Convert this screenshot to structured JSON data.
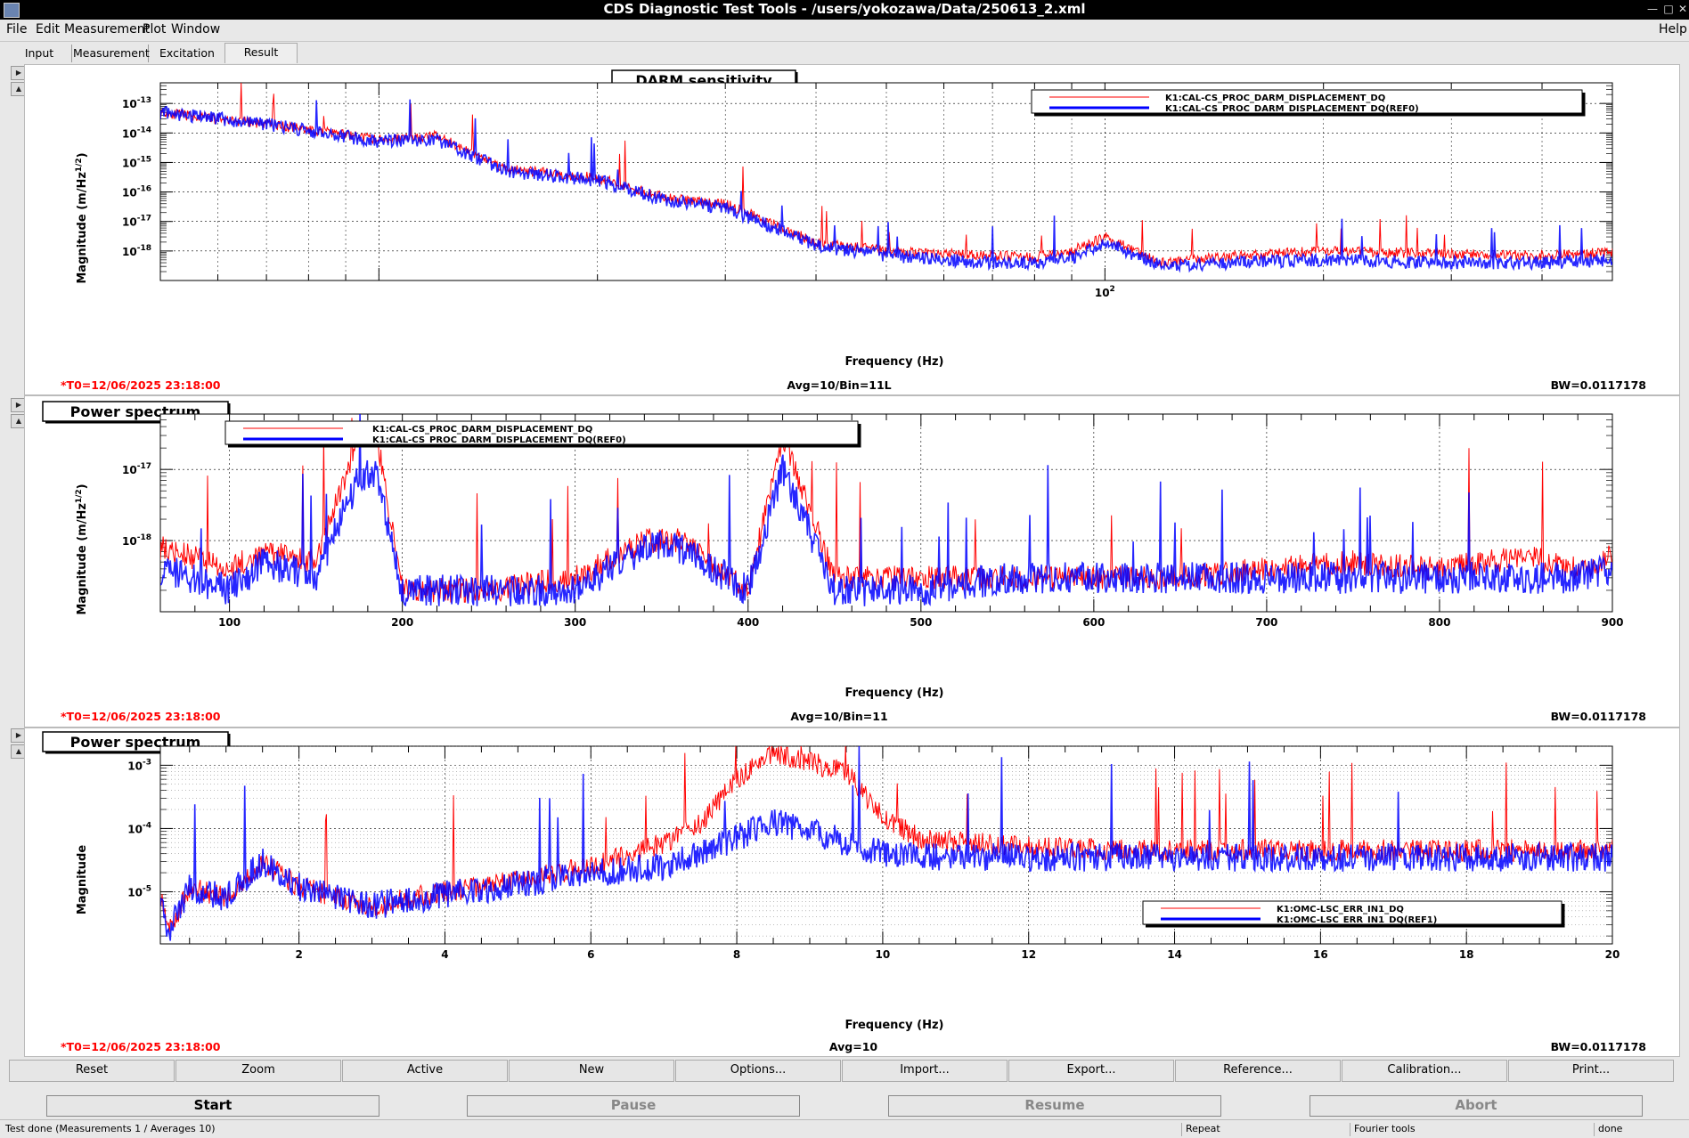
{
  "window": {
    "title": "CDS Diagnostic Test Tools - /users/yokozawa/Data/250613_2.xml"
  },
  "menu": {
    "file": "File",
    "edit": "Edit",
    "measurement": "Measurement",
    "plot": "Plot",
    "window": "Window",
    "help": "Help"
  },
  "tabs": [
    "Input",
    "Measurement",
    "Excitation",
    "Result"
  ],
  "colors": {
    "red": "#ff0000",
    "blue": "#0000ff",
    "info_red": "#ff0000"
  },
  "panels": [
    {
      "title": "DARM sensitivity",
      "ylabel_main": "Magnitude (m/Hz",
      "ylabel_sup": "1/2",
      "ylabel_end": ")",
      "xlabel": "Frequency (Hz)",
      "info_left": "*T0=12/06/2025 23:18:00",
      "info_center": "Avg=10/Bin=11L",
      "info_right": "BW=0.0117178",
      "ytick_labels": [
        {
          "base": "10",
          "exp": "-13"
        },
        {
          "base": "10",
          "exp": "-14"
        },
        {
          "base": "10",
          "exp": "-15"
        },
        {
          "base": "10",
          "exp": "-16"
        },
        {
          "base": "10",
          "exp": "-17"
        },
        {
          "base": "10",
          "exp": "-18"
        }
      ],
      "xtick_labels": [
        {
          "base": "10",
          "exp": "2"
        }
      ],
      "legend": [
        "K1:CAL-CS_PROC_DARM_DISPLACEMENT_DQ",
        "K1:CAL-CS_PROC_DARM_DISPLACEMENT_DQ(REF0)"
      ]
    },
    {
      "title": "Power spectrum",
      "ylabel_main": "Magnitude (m/Hz",
      "ylabel_sup": "1/2",
      "ylabel_end": ")",
      "xlabel": "Frequency (Hz)",
      "info_left": "*T0=12/06/2025 23:18:00",
      "info_center": "Avg=10/Bin=11",
      "info_right": "BW=0.0117178",
      "ytick_labels": [
        {
          "base": "10",
          "exp": "-17"
        },
        {
          "base": "10",
          "exp": "-18"
        }
      ],
      "xtick_labels": [
        "100",
        "200",
        "300",
        "400",
        "500",
        "600",
        "700",
        "800",
        "900"
      ],
      "legend": [
        "K1:CAL-CS_PROC_DARM_DISPLACEMENT_DQ",
        "K1:CAL-CS_PROC_DARM_DISPLACEMENT_DQ(REF0)"
      ]
    },
    {
      "title": "Power spectrum",
      "ylabel_main": "Magnitude",
      "ylabel_sup": "",
      "ylabel_end": "",
      "xlabel": "Frequency (Hz)",
      "info_left": "*T0=12/06/2025 23:18:00",
      "info_center": "Avg=10",
      "info_right": "BW=0.0117178",
      "ytick_labels": [
        {
          "base": "10",
          "exp": "-3"
        },
        {
          "base": "10",
          "exp": "-4"
        },
        {
          "base": "10",
          "exp": "-5"
        }
      ],
      "xtick_labels": [
        "2",
        "4",
        "6",
        "8",
        "10",
        "12",
        "14",
        "16",
        "18",
        "20"
      ],
      "legend": [
        "K1:OMC-LSC_ERR_IN1_DQ",
        "K1:OMC-LSC_ERR_IN1_DQ(REF1)"
      ]
    }
  ],
  "chart_data": [
    {
      "type": "line",
      "title": "DARM sensitivity",
      "xlabel": "Frequency (Hz)",
      "ylabel": "Magnitude (m/Hz^1/2)",
      "xscale": "log",
      "yscale": "log",
      "xlim": [
        5,
        500
      ],
      "ylim": [
        1e-19,
        5e-13
      ],
      "grid": true,
      "legend_position": "top-right",
      "series": [
        {
          "name": "K1:CAL-CS_PROC_DARM_DISPLACEMENT_DQ",
          "x": [
            5,
            7,
            10,
            12,
            15,
            20,
            25,
            30,
            40,
            50,
            60,
            70,
            80,
            90,
            100,
            120,
            150,
            200,
            300,
            400,
            500
          ],
          "y": [
            5e-14,
            2e-14,
            6e-15,
            8e-15,
            6e-16,
            3e-16,
            6e-17,
            4e-17,
            2e-18,
            1e-18,
            8e-19,
            7e-19,
            6e-19,
            1e-18,
            3e-18,
            4e-19,
            7e-19,
            1e-18,
            8e-19,
            7e-19,
            9e-19
          ]
        },
        {
          "name": "K1:CAL-CS_PROC_DARM_DISPLACEMENT_DQ(REF0)",
          "x": [
            5,
            7,
            10,
            12,
            15,
            20,
            25,
            30,
            40,
            50,
            60,
            70,
            80,
            90,
            100,
            120,
            150,
            200,
            300,
            400,
            500
          ],
          "y": [
            5e-14,
            2e-14,
            5e-15,
            6e-15,
            5e-16,
            2.5e-16,
            5e-17,
            3e-17,
            1.5e-18,
            7e-19,
            5e-19,
            4e-19,
            4e-19,
            6e-19,
            2e-18,
            3e-19,
            4e-19,
            5e-19,
            4e-19,
            4e-19,
            5e-19
          ]
        }
      ]
    },
    {
      "type": "line",
      "title": "Power spectrum",
      "xlabel": "Frequency (Hz)",
      "ylabel": "Magnitude (m/Hz^1/2)",
      "xscale": "linear",
      "yscale": "log",
      "xlim": [
        60,
        900
      ],
      "ylim": [
        1e-19,
        6e-17
      ],
      "grid": true,
      "legend_position": "top-left",
      "series": [
        {
          "name": "K1:CAL-CS_PROC_DARM_DISPLACEMENT_DQ",
          "x": [
            60,
            100,
            120,
            150,
            175,
            185,
            200,
            250,
            300,
            340,
            360,
            400,
            420,
            450,
            500,
            550,
            600,
            650,
            700,
            750,
            800,
            850,
            880,
            900
          ],
          "y": [
            8e-19,
            4e-19,
            7e-19,
            5e-19,
            3e-17,
            3e-17,
            2e-19,
            2e-19,
            3e-19,
            1e-18,
            1e-18,
            2e-19,
            3e-17,
            3e-19,
            3e-19,
            3e-19,
            3e-19,
            3e-19,
            4e-19,
            5e-19,
            4e-19,
            6e-19,
            4e-19,
            6e-19
          ]
        },
        {
          "name": "K1:CAL-CS_PROC_DARM_DISPLACEMENT_DQ(REF0)",
          "x": [
            60,
            100,
            120,
            150,
            175,
            185,
            200,
            250,
            300,
            340,
            360,
            400,
            420,
            450,
            500,
            550,
            600,
            650,
            700,
            750,
            800,
            850,
            880,
            900
          ],
          "y": [
            4e-19,
            2e-19,
            5e-19,
            3e-19,
            8e-18,
            8e-18,
            2e-19,
            2e-19,
            2e-19,
            8e-19,
            8e-19,
            2e-19,
            1e-17,
            2e-19,
            2e-19,
            3e-19,
            3e-19,
            3e-19,
            3e-19,
            3e-19,
            3e-19,
            3e-19,
            3e-19,
            4e-19
          ]
        }
      ]
    },
    {
      "type": "line",
      "title": "Power spectrum",
      "xlabel": "Frequency (Hz)",
      "ylabel": "Magnitude",
      "xscale": "linear",
      "yscale": "log",
      "xlim": [
        0.1,
        20
      ],
      "ylim": [
        1.5e-06,
        0.002
      ],
      "grid": true,
      "legend_position": "bottom-right",
      "series": [
        {
          "name": "K1:OMC-LSC_ERR_IN1_DQ",
          "x": [
            0.1,
            0.2,
            0.5,
            1,
            1.5,
            2,
            3,
            4,
            5,
            6,
            7,
            7.5,
            8,
            8.5,
            9,
            9.5,
            10,
            10.5,
            12,
            14,
            16,
            18,
            20
          ],
          "y": [
            1e-05,
            2e-06,
            1.2e-05,
            8e-06,
            3e-05,
            1.2e-05,
            6e-06,
            1e-05,
            1.5e-05,
            2.5e-05,
            6e-05,
            0.00012,
            0.0006,
            0.0016,
            0.0011,
            0.0008,
            0.00015,
            7e-05,
            5e-05,
            4.5e-05,
            4.5e-05,
            4.5e-05,
            4.5e-05
          ]
        },
        {
          "name": "K1:OMC-LSC_ERR_IN1_DQ(REF1)",
          "x": [
            0.1,
            0.2,
            0.5,
            1,
            1.5,
            2,
            3,
            4,
            5,
            6,
            7,
            7.5,
            8,
            8.5,
            9,
            9.5,
            10,
            10.5,
            12,
            14,
            16,
            18,
            20
          ],
          "y": [
            1e-05,
            2e-06,
            1.2e-05,
            8e-06,
            3e-05,
            1.2e-05,
            6e-06,
            9e-06,
            1.3e-05,
            2e-05,
            2.5e-05,
            4e-05,
            7e-05,
            0.00013,
            9e-05,
            6e-05,
            4e-05,
            3.5e-05,
            3.5e-05,
            3.5e-05,
            3.5e-05,
            3.5e-05,
            3.5e-05
          ]
        }
      ]
    }
  ],
  "toolbar": [
    "Reset",
    "Zoom",
    "Active",
    "New",
    "Options...",
    "Import...",
    "Export...",
    "Reference...",
    "Calibration...",
    "Print..."
  ],
  "controls": {
    "start": "Start",
    "pause": "Pause",
    "resume": "Resume",
    "abort": "Abort"
  },
  "status": {
    "message": "Test done (Measurements 1 / Averages 10)",
    "repeat": "Repeat",
    "fourier": "Fourier tools",
    "state": "done"
  }
}
